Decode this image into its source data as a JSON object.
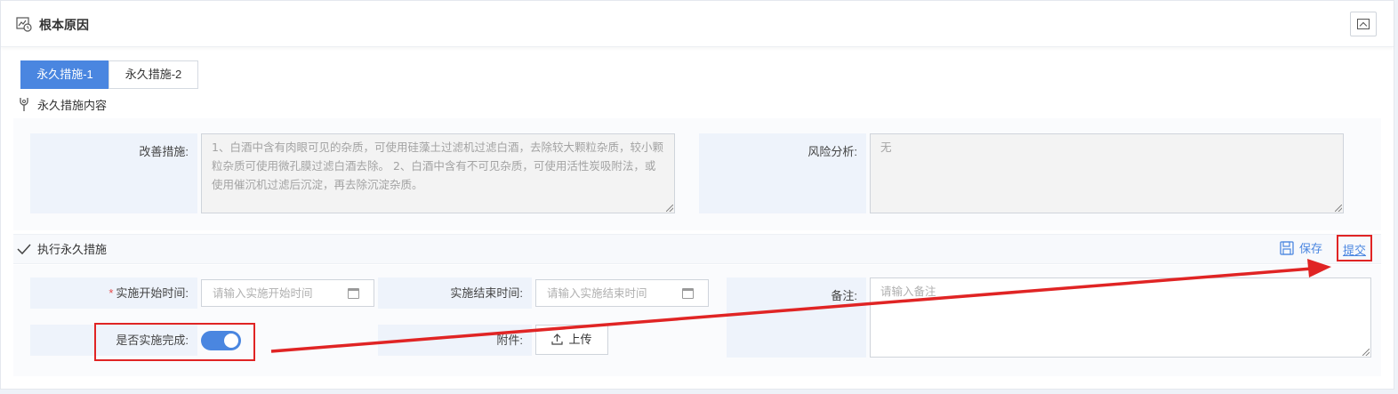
{
  "header": {
    "title": "根本原因"
  },
  "tabs": [
    {
      "label": "永久措施-1",
      "active": true
    },
    {
      "label": "永久措施-2",
      "active": false
    }
  ],
  "content_section": {
    "title": "永久措施内容",
    "improvement_label": "改善措施:",
    "improvement_value": "1、白酒中含有肉眼可见的杂质，可使用硅藻土过滤机过滤白酒，去除较大颗粒杂质，较小颗粒杂质可使用微孔膜过滤白酒去除。 2、白酒中含有不可见杂质，可使用活性炭吸附法，或使用催沉机过滤后沉淀，再去除沉淀杂质。",
    "risk_label": "风险分析:",
    "risk_value": "无"
  },
  "execute_section": {
    "title": "执行永久措施",
    "save_label": "保存",
    "submit_label": "提交",
    "start_label": "实施开始时间:",
    "start_placeholder": "请输入实施开始时间",
    "end_label": "实施结束时间:",
    "end_placeholder": "请输入实施结束时间",
    "remark_label": "备注:",
    "remark_placeholder": "请输入备注",
    "completed_label": "是否实施完成:",
    "completed_value": true,
    "attachment_label": "附件:",
    "upload_label": "上传"
  },
  "colors": {
    "accent": "#4a86e0",
    "annotation": "#e02424",
    "required": "#e54b4b"
  }
}
